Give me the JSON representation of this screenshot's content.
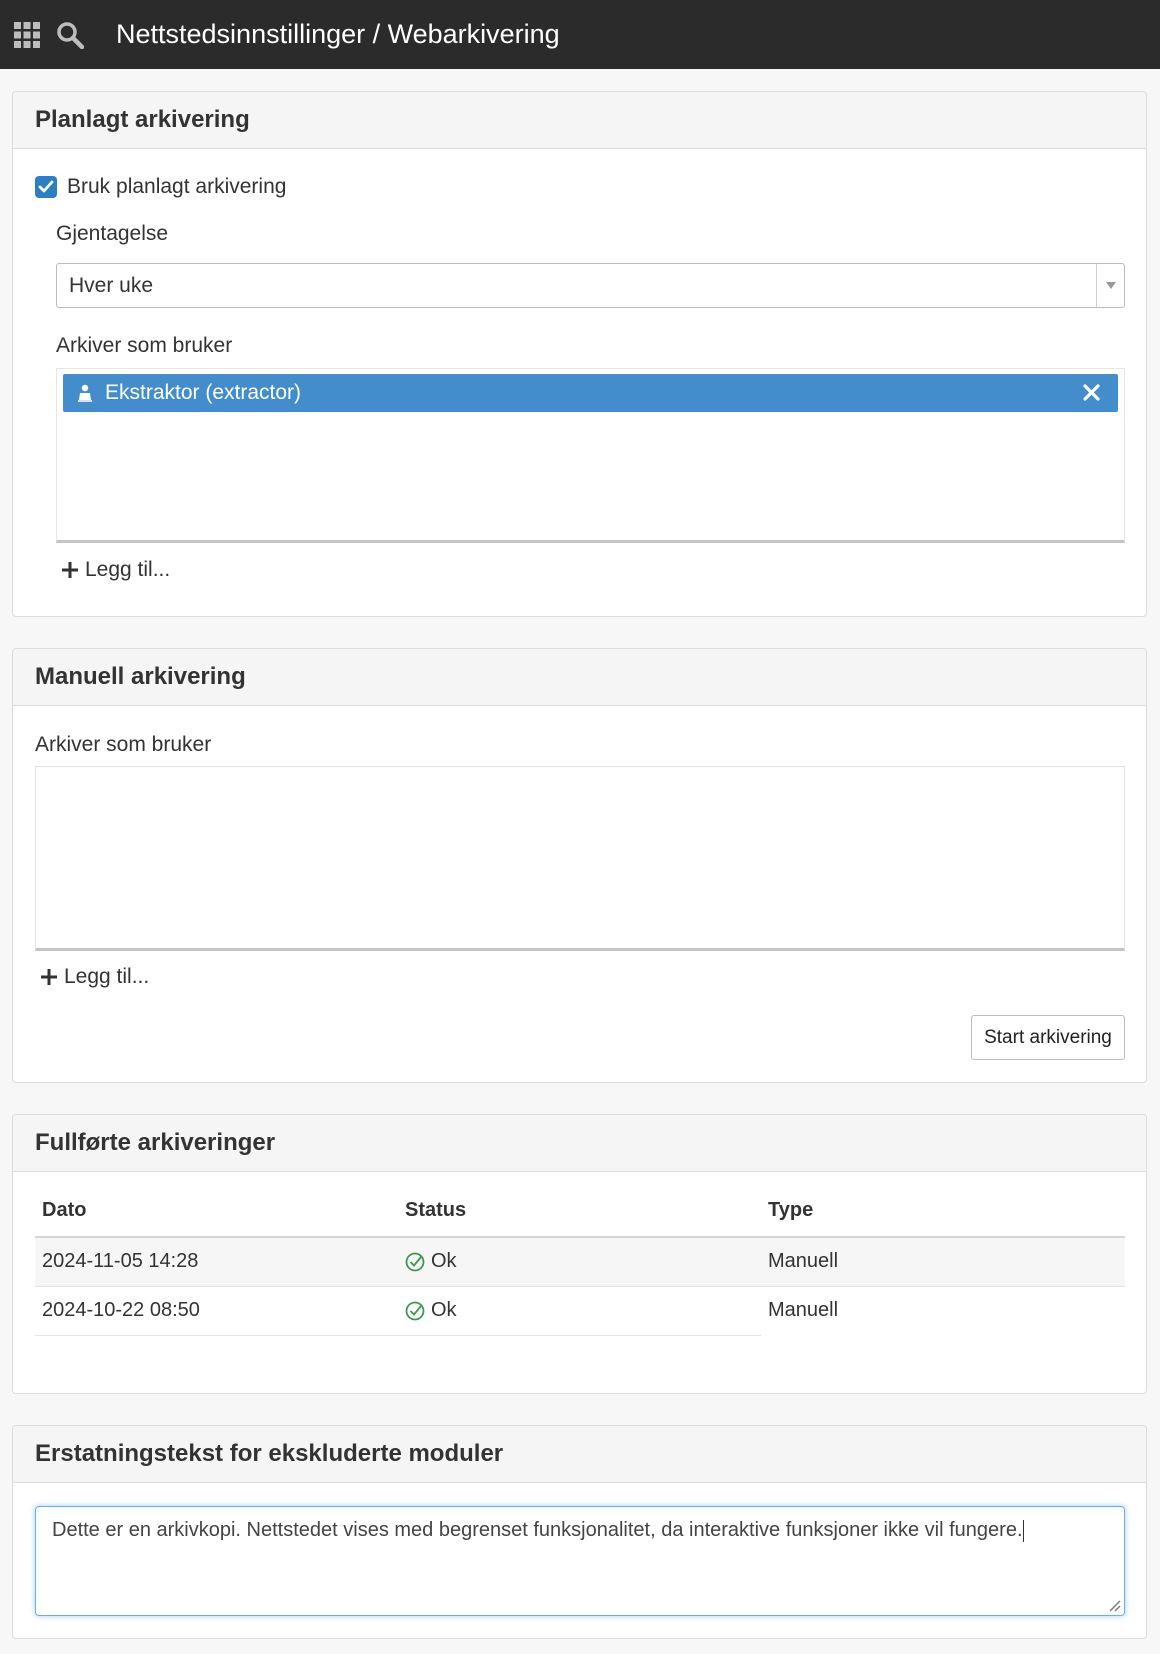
{
  "topbar": {
    "title": "Nettstedsinnstillinger / Webarkivering",
    "apps_icon": "grid-icon",
    "search_icon": "search-icon"
  },
  "scheduled": {
    "heading": "Planlagt arkivering",
    "checkbox_label": "Bruk planlagt arkivering",
    "checked": true,
    "repeat_label": "Gjentagelse",
    "repeat_value": "Hver uke",
    "user_label": "Arkiver som bruker",
    "users": [
      {
        "label": "Ekstraktor (extractor)"
      }
    ],
    "add_label": "Legg til..."
  },
  "manual": {
    "heading": "Manuell arkivering",
    "user_label": "Arkiver som bruker",
    "add_label": "Legg til...",
    "start_button": "Start arkivering"
  },
  "completed": {
    "heading": "Fullførte arkiveringer",
    "columns": [
      "Dato",
      "Status",
      "Type"
    ],
    "rows": [
      {
        "date": "2024-11-05 14:28",
        "status": "Ok",
        "type": "Manuell"
      },
      {
        "date": "2024-10-22 08:50",
        "status": "Ok",
        "type": "Manuell"
      }
    ]
  },
  "replacement": {
    "heading": "Erstatningstekst for ekskluderte moduler",
    "text": "Dette er en arkivkopi. Nettstedet vises med begrenset funksjonalitet, da interaktive funksjoner ikke vil fungere."
  },
  "colors": {
    "accent": "#438dcc",
    "topbar": "#2b2b2b",
    "ok_green": "#3c9a4f"
  }
}
